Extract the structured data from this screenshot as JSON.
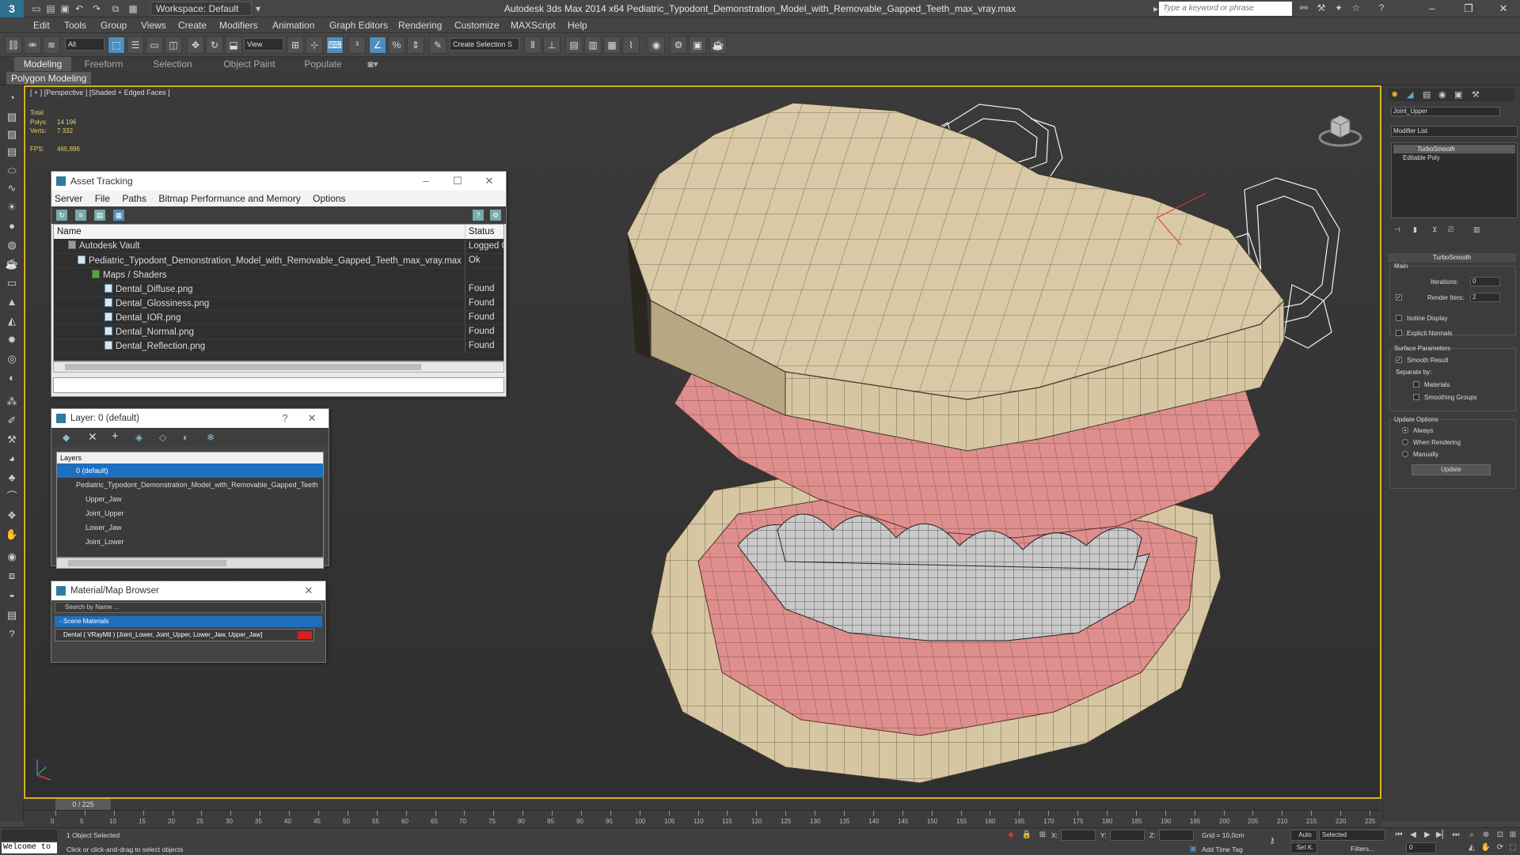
{
  "app": {
    "logo": "3",
    "workspace": "Workspace: Default",
    "title": "Autodesk 3ds Max  2014 x64      Pediatric_Typodont_Demonstration_Model_with_Removable_Gapped_Teeth_max_vray.max",
    "search_placeholder": "Type a keyword or phrase"
  },
  "menu": [
    "Edit",
    "Tools",
    "Group",
    "Views",
    "Create",
    "Modifiers",
    "Animation",
    "Graph Editors",
    "Rendering",
    "Customize",
    "MAXScript",
    "Help"
  ],
  "toolbar": {
    "selection_filter": "All",
    "ref_coord": "View",
    "named_selection": "Create Selection S"
  },
  "ribbon": {
    "tabs": [
      "Modeling",
      "Freeform",
      "Selection",
      "Object Paint",
      "Populate"
    ],
    "panel": "Polygon Modeling"
  },
  "viewport": {
    "label": "[ + ] [Perspective ] [Shaded + Edged Faces ]",
    "stats": {
      "total_label": "Total",
      "polys_label": "Polys:",
      "polys": "14 196",
      "verts_label": "Verts:",
      "verts": "7 332",
      "fps_label": "FPS:",
      "fps": "465,896"
    }
  },
  "asset_tracking": {
    "title": "Asset Tracking",
    "menu": [
      "Server",
      "File",
      "Paths",
      "Bitmap Performance and Memory",
      "Options"
    ],
    "columns": [
      "Name",
      "Status"
    ],
    "rows": [
      {
        "name": "Autodesk Vault",
        "status": "Logged O..."
      },
      {
        "name": "Pediatric_Typodont_Demonstration_Model_with_Removable_Gapped_Teeth_max_vray.max",
        "status": "Ok"
      },
      {
        "name": "Maps / Shaders",
        "status": ""
      },
      {
        "name": "Dental_Diffuse.png",
        "status": "Found"
      },
      {
        "name": "Dental_Glossiness.png",
        "status": "Found"
      },
      {
        "name": "Dental_IOR.png",
        "status": "Found"
      },
      {
        "name": "Dental_Normal.png",
        "status": "Found"
      },
      {
        "name": "Dental_Reflection.png",
        "status": "Found"
      }
    ]
  },
  "layer": {
    "title": "Layer: 0 (default)",
    "header": "Layers",
    "rows": [
      "0 (default)",
      "Pediatric_Typodont_Demonstration_Model_with_Removable_Gapped_Teeth",
      "Upper_Jaw",
      "Joint_Upper",
      "Lower_Jaw",
      "Joint_Lower"
    ]
  },
  "material_browser": {
    "title": "Material/Map Browser",
    "search_placeholder": "Search by Name ...",
    "group": "- Scene Materials",
    "item": "Dental  ( VRayMtl ) [Joint_Lower, Joint_Upper, Lower_Jaw, Upper_Jaw]",
    "swatch": "#d42020"
  },
  "command_panel": {
    "object_name": "Joint_Upper",
    "modifier_list": "Modifier List",
    "stack": [
      "TurboSmooth",
      "Editable Poly"
    ],
    "rollout": "TurboSmooth",
    "main_label": "Main",
    "iterations_label": "Iterations:",
    "iterations": "0",
    "render_iters_label": "Render Iters:",
    "render_iters": "2",
    "isoline": "Isoline Display",
    "explicit": "Explicit Normals",
    "surface_label": "Surface Parameters",
    "smooth_result": "Smooth Result",
    "separate_by": "Separate by:",
    "materials": "Materials",
    "smoothing_groups": "Smoothing Groups",
    "update_options": "Update Options",
    "always": "Always",
    "when_rendering": "When Rendering",
    "manually": "Manually",
    "update_btn": "Update"
  },
  "timeline": {
    "slider": "0 / 225",
    "ticks": [
      "0",
      "5",
      "10",
      "15",
      "20",
      "25",
      "30",
      "35",
      "40",
      "45",
      "50",
      "55",
      "60",
      "65",
      "70",
      "75",
      "80",
      "85",
      "90",
      "95",
      "100",
      "105",
      "110",
      "115",
      "120",
      "125",
      "130",
      "135",
      "140",
      "145",
      "150",
      "155",
      "160",
      "165",
      "170",
      "175",
      "180",
      "185",
      "190",
      "195",
      "200",
      "205",
      "210",
      "215",
      "220",
      "225"
    ]
  },
  "status": {
    "listener": "Welcome to",
    "selected": "1 Object Selected",
    "prompt": "Click or click-and-drag to select objects",
    "x_label": "X:",
    "y_label": "Y:",
    "z_label": "Z:",
    "grid": "Grid = 10,0cm",
    "add_time_tag": "Add Time Tag",
    "auto": "Auto",
    "selected_dd": "Selected",
    "set_key": "Set K.",
    "filters": "Filters...",
    "frame": "0"
  }
}
